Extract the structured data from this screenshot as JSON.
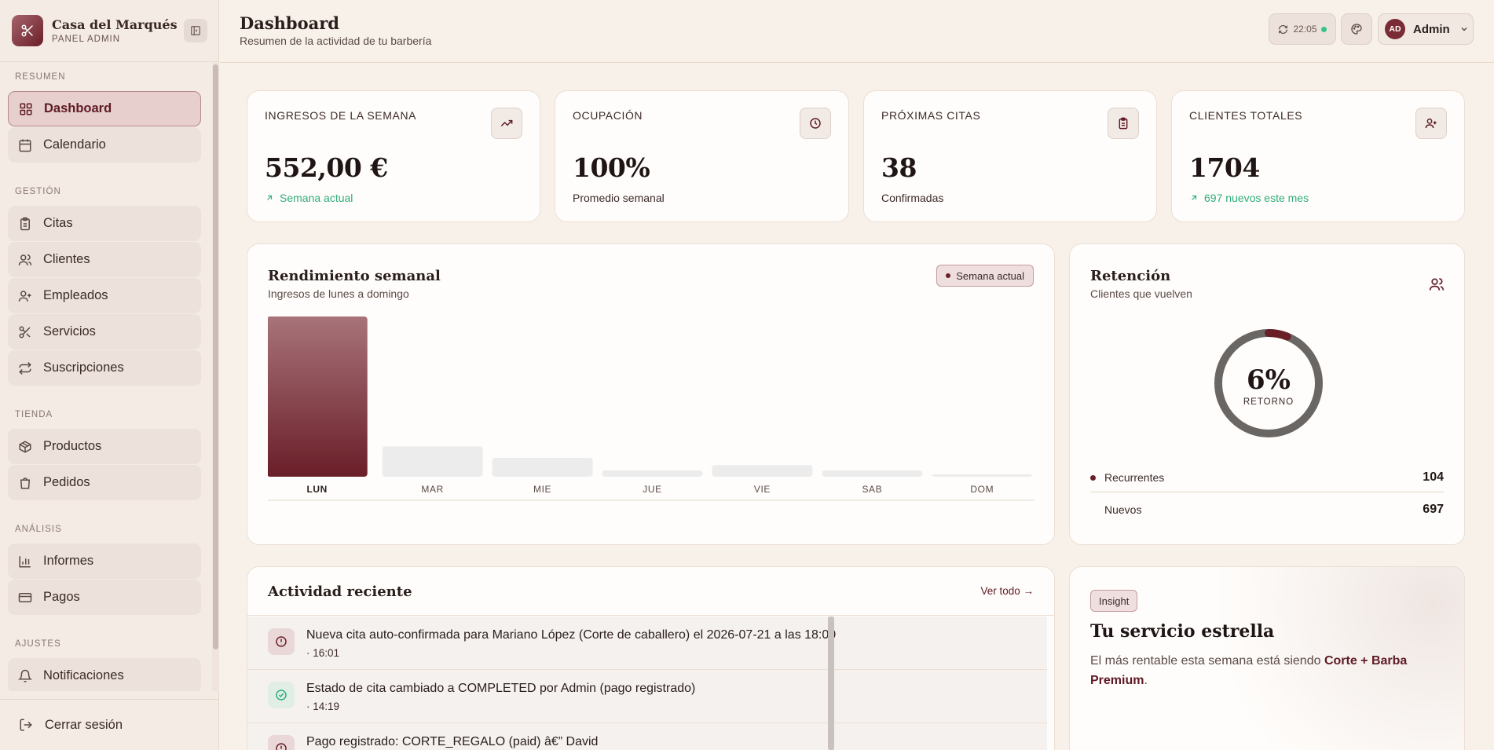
{
  "brand": {
    "name": "Casa del Marqués",
    "subtitle": "PANEL ADMIN"
  },
  "sidebar": {
    "sections": [
      {
        "label": "RESUMEN",
        "items": [
          "Dashboard",
          "Calendario"
        ]
      },
      {
        "label": "GESTIÓN",
        "items": [
          "Citas",
          "Clientes",
          "Empleados",
          "Servicios",
          "Suscripciones"
        ]
      },
      {
        "label": "TIENDA",
        "items": [
          "Productos",
          "Pedidos"
        ]
      },
      {
        "label": "ANÁLISIS",
        "items": [
          "Informes",
          "Pagos"
        ]
      },
      {
        "label": "AJUSTES",
        "items": [
          "Notificaciones"
        ]
      }
    ],
    "active_item": "Dashboard",
    "logout_label": "Cerrar sesión"
  },
  "header": {
    "title": "Dashboard",
    "subtitle": "Resumen de la actividad de tu barbería",
    "clock": "22:05",
    "user_initials": "AD",
    "user_name": "Admin"
  },
  "kpis": [
    {
      "label": "INGRESOS DE LA SEMANA",
      "value": "552,00 €",
      "note": "Semana actual",
      "note_style": "green",
      "icon": "trending-up-icon"
    },
    {
      "label": "OCUPACIÓN",
      "value": "100%",
      "note": "Promedio semanal",
      "note_style": "plain",
      "icon": "clock-icon"
    },
    {
      "label": "PRÓXIMAS CITAS",
      "value": "38",
      "note": "Confirmadas",
      "note_style": "plain",
      "icon": "clipboard-icon"
    },
    {
      "label": "CLIENTES TOTALES",
      "value": "1704",
      "note": "697 nuevos este mes",
      "note_style": "green",
      "icon": "user-plus-icon"
    }
  ],
  "weekly": {
    "title": "Rendimiento semanal",
    "subtitle": "Ingresos de lunes a domingo",
    "badge": "Semana actual"
  },
  "chart_data": {
    "type": "bar",
    "categories": [
      "LUN",
      "MAR",
      "MIE",
      "JUE",
      "VIE",
      "SAB",
      "DOM"
    ],
    "values": [
      552,
      105,
      65,
      22,
      40,
      22,
      4
    ],
    "highlight": "LUN",
    "title": "Rendimiento semanal",
    "subtitle": "Ingresos de lunes a domingo",
    "xlabel": "",
    "ylabel": "",
    "ylim": [
      0,
      552
    ],
    "grid": false,
    "colors": {
      "highlight_top": "#a8737a",
      "highlight_bottom": "#6a1e28",
      "other": "#ececec"
    }
  },
  "retention": {
    "title": "Retención",
    "subtitle": "Clientes que vuelven",
    "percent_label": "6%",
    "percent_value": 0.06,
    "center_caption": "RETORNO",
    "rows": [
      {
        "label": "Recurrentes",
        "value": "104"
      },
      {
        "label": "Nuevos",
        "value": "697"
      }
    ]
  },
  "activity": {
    "title": "Actividad reciente",
    "view_all": "Ver todo →",
    "items": [
      {
        "text": "Nueva cita auto-confirmada para Mariano López (Corte de caballero) el 2026-07-21 a las 18:00",
        "time": "· 16:01",
        "type": "alert"
      },
      {
        "text": "Estado de cita cambiado a COMPLETED por Admin (pago registrado)",
        "time": "· 14:19",
        "type": "ok"
      },
      {
        "text": "Pago registrado: CORTE_REGALO (paid) â€” David",
        "time": "",
        "type": "alert"
      }
    ]
  },
  "insight": {
    "badge": "Insight",
    "title": "Tu servicio estrella",
    "text_before": "El más rentable esta semana está siendo ",
    "highlight": "Corte + Barba Premium",
    "text_after": "."
  },
  "colors": {
    "accent": "#6a1e28",
    "background": "#f8f1ea",
    "positive": "#2fae7a"
  }
}
